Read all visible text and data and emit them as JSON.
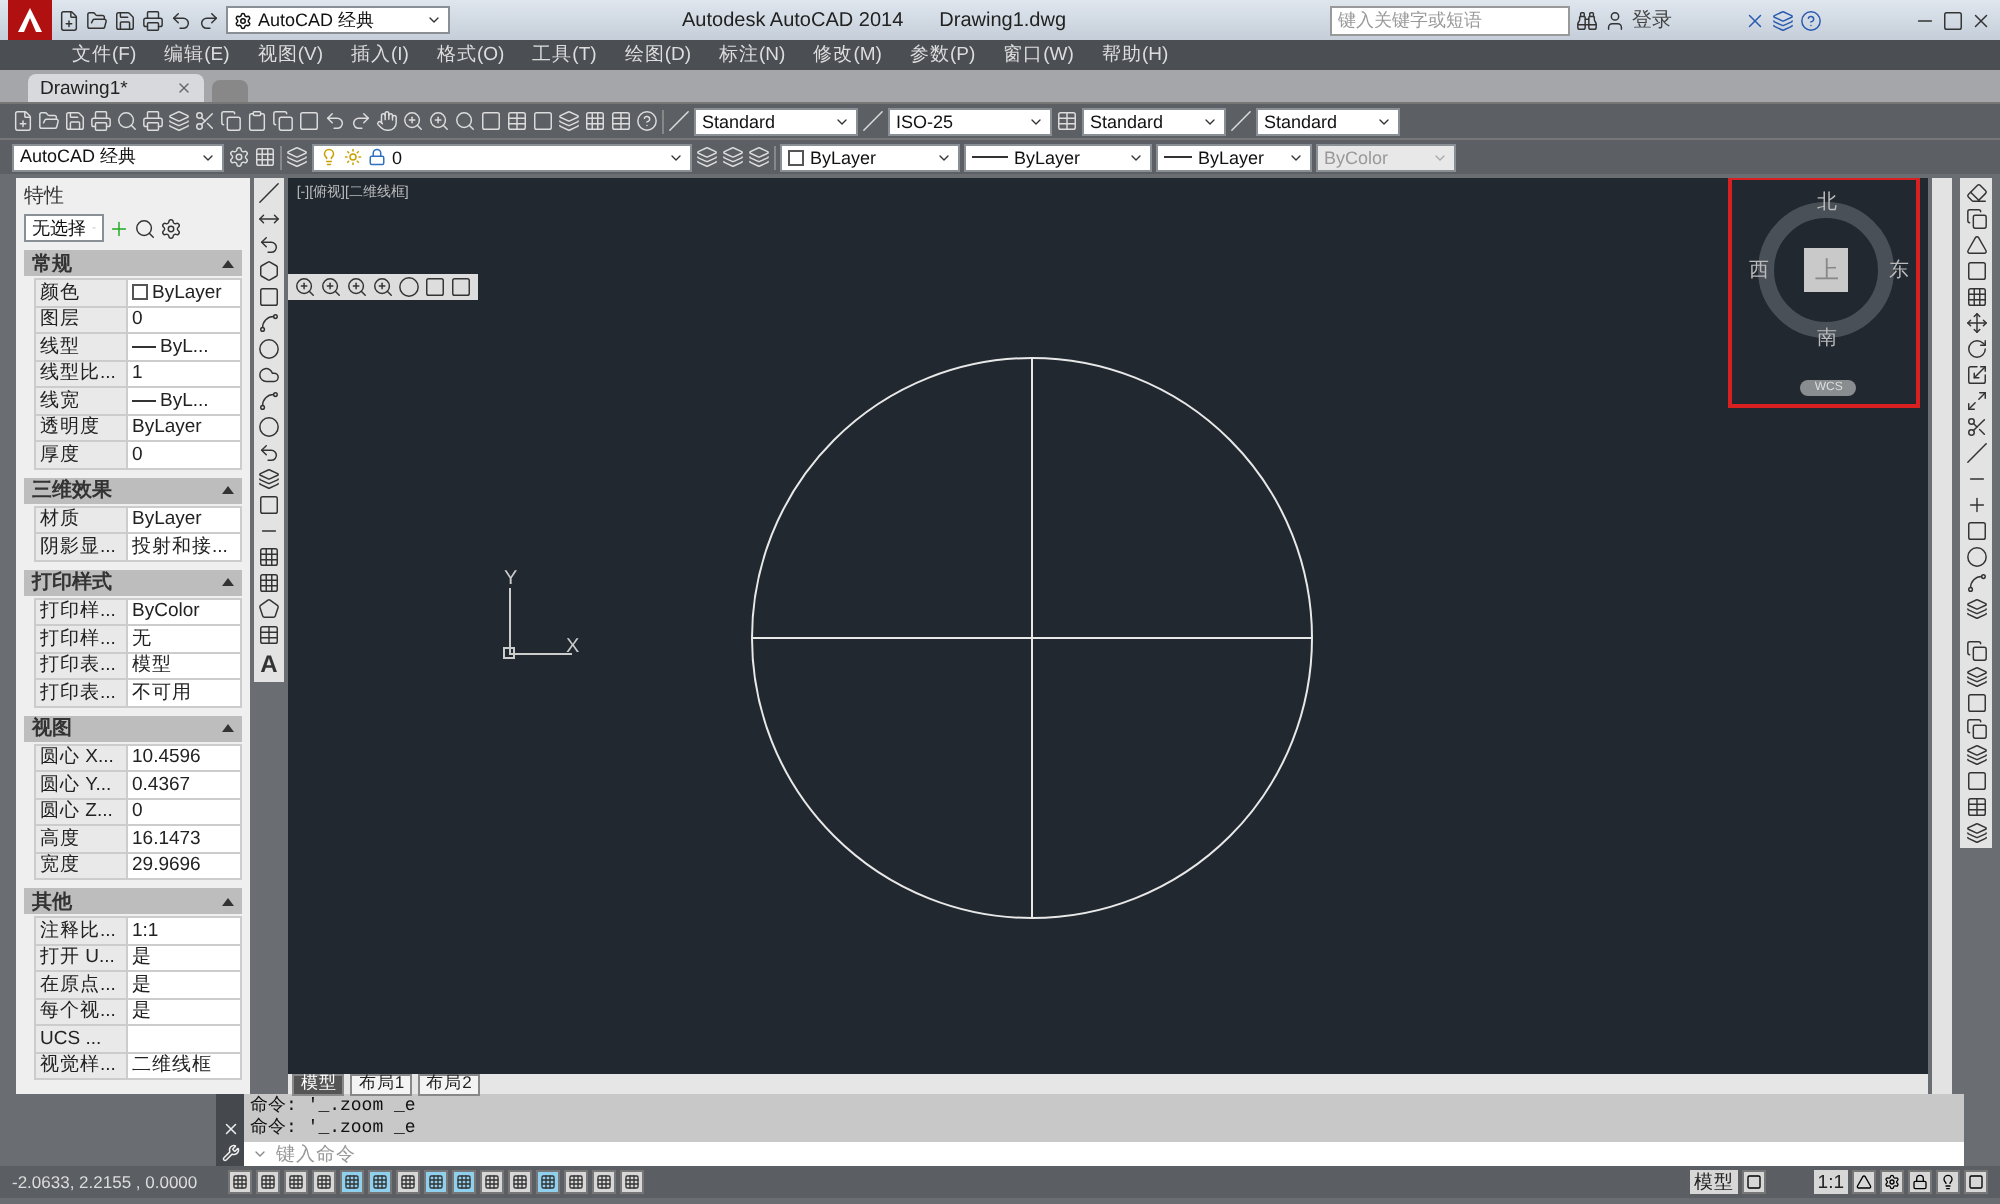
{
  "title_bar": {
    "workspace": "AutoCAD 经典",
    "app_title": "Autodesk AutoCAD 2014",
    "file_name": "Drawing1.dwg",
    "search": {
      "placeholder": "键入关键字或短语"
    },
    "sign_in": "登录"
  },
  "menu": [
    "文件(F)",
    "编辑(E)",
    "视图(V)",
    "插入(I)",
    "格式(O)",
    "工具(T)",
    "绘图(D)",
    "标注(N)",
    "修改(M)",
    "参数(P)",
    "窗口(W)",
    "帮助(H)"
  ],
  "doc_tabs": [
    {
      "label": "Drawing1*",
      "selected": true
    }
  ],
  "style_toolbar": {
    "text_style": "Standard",
    "dim_style": "ISO-25",
    "table_style": "Standard",
    "multileader_style": "Standard"
  },
  "layer_toolbar": {
    "workspace": "AutoCAD 经典",
    "layer": "0",
    "color_control": "ByLayer",
    "linetype": "ByLayer",
    "lineweight": "ByLayer",
    "plot_style": {
      "value": "ByColor",
      "disabled": true
    }
  },
  "properties": {
    "title": "特性",
    "selection": "无选择",
    "sections": [
      {
        "title": "常规",
        "expanded": true,
        "rows": [
          {
            "label": "颜色",
            "value": "ByLayer",
            "kind": "color"
          },
          {
            "label": "图层",
            "value": "0",
            "kind": "text"
          },
          {
            "label": "线型",
            "value": "ByL...",
            "kind": "line"
          },
          {
            "label": "线型比...",
            "value": "1",
            "kind": "text"
          },
          {
            "label": "线宽",
            "value": "ByL...",
            "kind": "line"
          },
          {
            "label": "透明度",
            "value": "ByLayer",
            "kind": "text"
          },
          {
            "label": "厚度",
            "value": "0",
            "kind": "text"
          }
        ]
      },
      {
        "title": "三维效果",
        "expanded": true,
        "rows": [
          {
            "label": "材质",
            "value": "ByLayer",
            "kind": "text"
          },
          {
            "label": "阴影显...",
            "value": "投射和接...",
            "kind": "text"
          }
        ]
      },
      {
        "title": "打印样式",
        "expanded": true,
        "rows": [
          {
            "label": "打印样...",
            "value": "ByColor",
            "kind": "text"
          },
          {
            "label": "打印样...",
            "value": "无",
            "kind": "text"
          },
          {
            "label": "打印表...",
            "value": "模型",
            "kind": "text"
          },
          {
            "label": "打印表...",
            "value": "不可用",
            "kind": "text"
          }
        ]
      },
      {
        "title": "视图",
        "expanded": true,
        "rows": [
          {
            "label": "圆心 X...",
            "value": "10.4596",
            "kind": "text"
          },
          {
            "label": "圆心 Y...",
            "value": "0.4367",
            "kind": "text"
          },
          {
            "label": "圆心 Z...",
            "value": "0",
            "kind": "text"
          },
          {
            "label": "高度",
            "value": "16.1473",
            "kind": "text"
          },
          {
            "label": "宽度",
            "value": "29.9696",
            "kind": "text"
          }
        ]
      },
      {
        "title": "其他",
        "expanded": true,
        "rows": [
          {
            "label": "注释比...",
            "value": "1:1",
            "kind": "text"
          },
          {
            "label": "打开 U...",
            "value": "是",
            "kind": "text"
          },
          {
            "label": "在原点...",
            "value": "是",
            "kind": "text"
          },
          {
            "label": "每个视...",
            "value": "是",
            "kind": "text"
          },
          {
            "label": "UCS ...",
            "value": "",
            "kind": "text"
          },
          {
            "label": "视觉样...",
            "value": "二维线框",
            "kind": "text"
          }
        ]
      }
    ]
  },
  "draw_toolbar": {
    "text_tool": "A"
  },
  "viewport": {
    "label": "[-][俯视][二维线框]",
    "viewcube": {
      "north": "北",
      "south": "南",
      "east": "东",
      "west": "西",
      "face": "上",
      "ucs": "WCS"
    },
    "ucs_axes": {
      "x": "X",
      "y": "Y"
    }
  },
  "layout_tabs": [
    {
      "label": "模型",
      "selected": true
    },
    {
      "label": "布局1",
      "selected": false
    },
    {
      "label": "布局2",
      "selected": false
    }
  ],
  "command": {
    "history": [
      "命令: '_.zoom _e",
      "命令: '_.zoom _e"
    ],
    "placeholder": "键入命令"
  },
  "status_bar": {
    "coordinates": "-2.0633, 2.2155 , 0.0000",
    "toggles": [
      {
        "on": false
      },
      {
        "on": false
      },
      {
        "on": false
      },
      {
        "on": false
      },
      {
        "on": true
      },
      {
        "on": true
      },
      {
        "on": false
      },
      {
        "on": true
      },
      {
        "on": true
      },
      {
        "on": false
      },
      {
        "on": false
      },
      {
        "on": true
      },
      {
        "on": false
      },
      {
        "on": false
      },
      {
        "on": false
      }
    ],
    "model": "模型",
    "scale": "1:1"
  }
}
